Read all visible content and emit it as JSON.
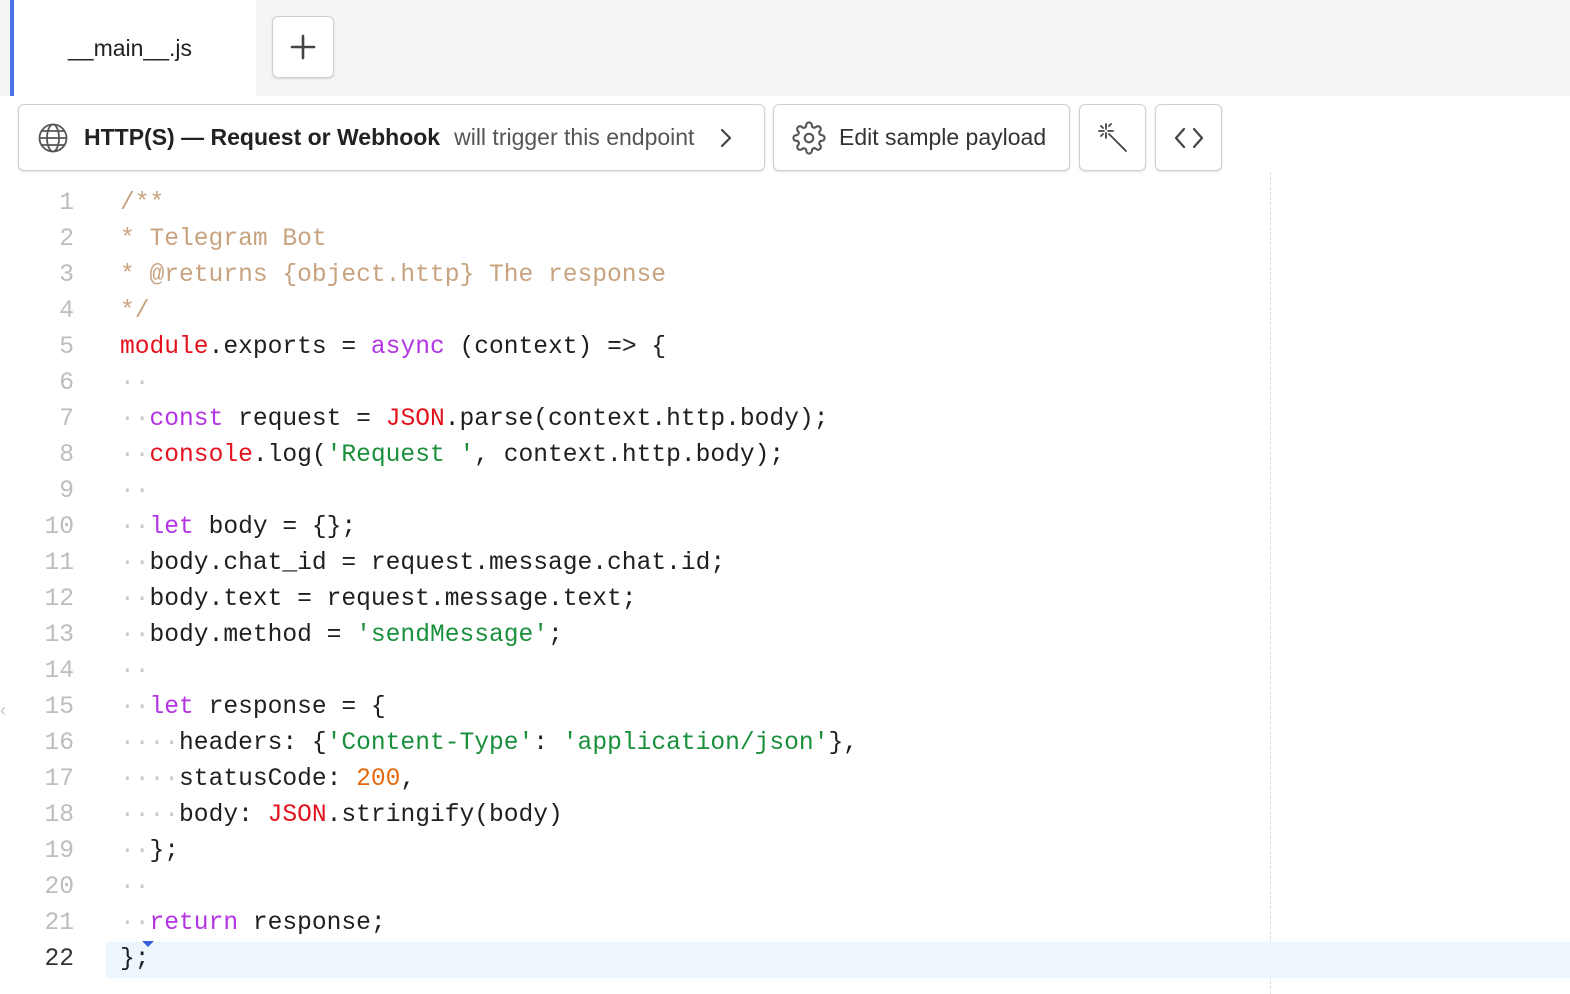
{
  "tabs": [
    {
      "label": "__main__.js"
    }
  ],
  "add_tab_label": "+",
  "trigger": {
    "type": "HTTP(S) — Request or Webhook",
    "suffix": "will trigger this endpoint"
  },
  "payload_button": {
    "label": "Edit sample payload"
  },
  "editor": {
    "active_line": 22,
    "lines": [
      {
        "num": "1",
        "tokens": [
          {
            "t": "/**",
            "c": "comment"
          }
        ]
      },
      {
        "num": "2",
        "tokens": [
          {
            "t": "* Telegram Bot",
            "c": "comment"
          }
        ]
      },
      {
        "num": "3",
        "tokens": [
          {
            "t": "* @returns {object.http} The response",
            "c": "comment"
          }
        ]
      },
      {
        "num": "4",
        "tokens": [
          {
            "t": "*/",
            "c": "comment"
          }
        ]
      },
      {
        "num": "5",
        "tokens": [
          {
            "t": "module",
            "c": "red"
          },
          {
            "t": ".exports = ",
            "c": "plain"
          },
          {
            "t": "async",
            "c": "purple"
          },
          {
            "t": " (context) => {",
            "c": "plain"
          }
        ]
      },
      {
        "num": "6",
        "tokens": [
          {
            "t": "··",
            "c": "ws"
          }
        ]
      },
      {
        "num": "7",
        "tokens": [
          {
            "t": "··",
            "c": "ws"
          },
          {
            "t": "const",
            "c": "purple"
          },
          {
            "t": " request = ",
            "c": "plain"
          },
          {
            "t": "JSON",
            "c": "red"
          },
          {
            "t": ".parse(context.http.body);",
            "c": "plain"
          }
        ]
      },
      {
        "num": "8",
        "tokens": [
          {
            "t": "··",
            "c": "ws"
          },
          {
            "t": "console",
            "c": "red"
          },
          {
            "t": ".log(",
            "c": "plain"
          },
          {
            "t": "'Request '",
            "c": "green"
          },
          {
            "t": ", context.http.body);",
            "c": "plain"
          }
        ]
      },
      {
        "num": "9",
        "tokens": [
          {
            "t": "··",
            "c": "ws"
          }
        ]
      },
      {
        "num": "10",
        "tokens": [
          {
            "t": "··",
            "c": "ws"
          },
          {
            "t": "let",
            "c": "purple"
          },
          {
            "t": " body = {};",
            "c": "plain"
          }
        ]
      },
      {
        "num": "11",
        "tokens": [
          {
            "t": "··",
            "c": "ws"
          },
          {
            "t": "body.chat_id = request.message.chat.id;",
            "c": "plain"
          }
        ]
      },
      {
        "num": "12",
        "tokens": [
          {
            "t": "··",
            "c": "ws"
          },
          {
            "t": "body.text = request.message.text;",
            "c": "plain"
          }
        ]
      },
      {
        "num": "13",
        "tokens": [
          {
            "t": "··",
            "c": "ws"
          },
          {
            "t": "body.method = ",
            "c": "plain"
          },
          {
            "t": "'sendMessage'",
            "c": "green"
          },
          {
            "t": ";",
            "c": "plain"
          }
        ]
      },
      {
        "num": "14",
        "tokens": [
          {
            "t": "··",
            "c": "ws"
          }
        ]
      },
      {
        "num": "15",
        "tokens": [
          {
            "t": "··",
            "c": "ws"
          },
          {
            "t": "let",
            "c": "purple"
          },
          {
            "t": " response = {",
            "c": "plain"
          }
        ]
      },
      {
        "num": "16",
        "tokens": [
          {
            "t": "····",
            "c": "ws"
          },
          {
            "t": "headers: {",
            "c": "plain"
          },
          {
            "t": "'Content-Type'",
            "c": "green"
          },
          {
            "t": ": ",
            "c": "plain"
          },
          {
            "t": "'application/json'",
            "c": "green"
          },
          {
            "t": "},",
            "c": "plain"
          }
        ]
      },
      {
        "num": "17",
        "tokens": [
          {
            "t": "····",
            "c": "ws"
          },
          {
            "t": "statusCode: ",
            "c": "plain"
          },
          {
            "t": "200",
            "c": "orange"
          },
          {
            "t": ",",
            "c": "plain"
          }
        ]
      },
      {
        "num": "18",
        "tokens": [
          {
            "t": "····",
            "c": "ws"
          },
          {
            "t": "body: ",
            "c": "plain"
          },
          {
            "t": "JSON",
            "c": "red"
          },
          {
            "t": ".stringify(body)",
            "c": "plain"
          }
        ]
      },
      {
        "num": "19",
        "tokens": [
          {
            "t": "··",
            "c": "ws"
          },
          {
            "t": "};",
            "c": "plain"
          }
        ]
      },
      {
        "num": "20",
        "tokens": [
          {
            "t": "··",
            "c": "ws"
          }
        ]
      },
      {
        "num": "21",
        "tokens": [
          {
            "t": "··",
            "c": "ws"
          },
          {
            "t": "return",
            "c": "purple"
          },
          {
            "t": " response;",
            "c": "plain"
          }
        ]
      },
      {
        "num": "22",
        "tokens": [
          {
            "t": "};",
            "c": "plain"
          }
        ]
      }
    ]
  },
  "icons": {
    "trigger": "globe-icon",
    "trigger_arrow": "chevron-right-icon",
    "payload": "gear-icon",
    "magic": "magic-wand-icon",
    "code": "code-brackets-icon"
  },
  "colors": {
    "accent": "#4a73e8",
    "comment": "#c8a37f",
    "keyword_purple": "#b234e3",
    "builtin_red": "#e3121d",
    "string_green": "#1a8f3c",
    "number_orange": "#e3690e",
    "active_line_bg": "#edf6fc"
  }
}
